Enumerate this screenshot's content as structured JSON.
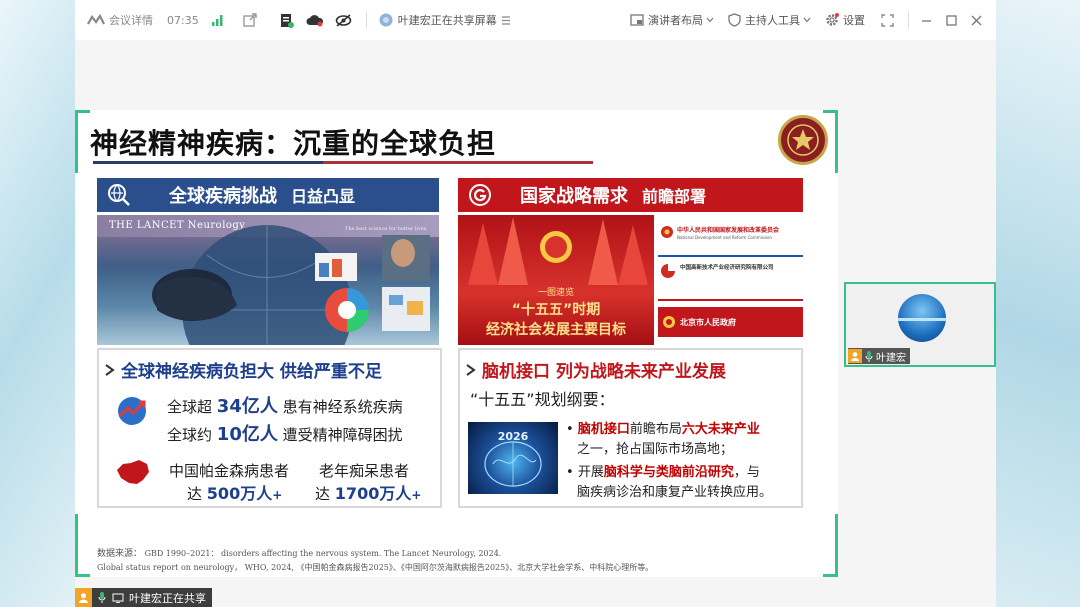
{
  "toolbar": {
    "meeting_details": "会议详情",
    "time": "07:35",
    "sharing_status": "叶建宏正在共享屏幕",
    "presenter_layout": "演讲者布局",
    "host_tools": "主持人工具",
    "settings": "设置"
  },
  "slide": {
    "title": "神经精神疾病：沉重的全球负担",
    "left_panel": {
      "head_big": "全球疾病挑战",
      "head_small": "日益凸显",
      "image_caption": "THE LANCET Neurology",
      "image_tagline": "The best science for better lives",
      "bullet_head": "全球神经疾病负担大 供给严重不足",
      "line1_prefix": "全球超",
      "line1_value": "34亿人",
      "line1_suffix": "患有神经系统疾病",
      "line2_prefix": "全球约",
      "line2_value": "10亿人",
      "line2_suffix": "遭受精神障碍困扰",
      "pd_label": "中国帕金森病患者",
      "pd_prefix": "达",
      "pd_value": "500万人",
      "pd_plus": "+",
      "ad_label": "老年痴呆患者",
      "ad_prefix": "达",
      "ad_value": "1700万人",
      "ad_plus": "+"
    },
    "right_panel": {
      "head_big": "国家战略需求",
      "head_small": "前瞻部署",
      "banner_small": "一图速览",
      "banner_mid": "“十五五”时期",
      "banner_big": "经济社会发展主要目标",
      "site1": "中华人民共和国国家发展和改革委员会",
      "site1_en": "National Development and Reform Commission",
      "site2": "中国高新技术产业经济研究院有限公司",
      "site3": "北京市人民政府",
      "bullet_head": "脑机接口 列为战略未来产业发展",
      "plan": "“十五五”规划纲要：",
      "year_badge": "2026",
      "p1_a": "脑机接口",
      "p1_b": "前瞻布局",
      "p1_c": "六大未来产业",
      "p1_d": "之一，抢占国际市场高地；",
      "p2_a": "开展",
      "p2_b": "脑科学与类脑前沿研究",
      "p2_c": "，与",
      "p2_d": "脑疾病诊治和康复产业转换应用。"
    },
    "source_line1_a": "数据来源：",
    "source_line1_b": "GBD 1990–2021： disorders affecting the nervous system. The Lancet Neurology, 2024.",
    "source_line2": "Global status report on neurology， WHO, 2024, 《中国帕金森病报告2025》、《中国阿尔茨海默病报告2025》、北京大学社会学系、中科院心理所等。"
  },
  "participant": {
    "name": "叶建宏"
  },
  "share_bar": {
    "label": "叶建宏正在共享"
  },
  "colors": {
    "accent_green": "#36c08a",
    "panel_blue": "#2b4f8c",
    "panel_red": "#c0161c",
    "dark_navy": "#1e3f8c"
  }
}
